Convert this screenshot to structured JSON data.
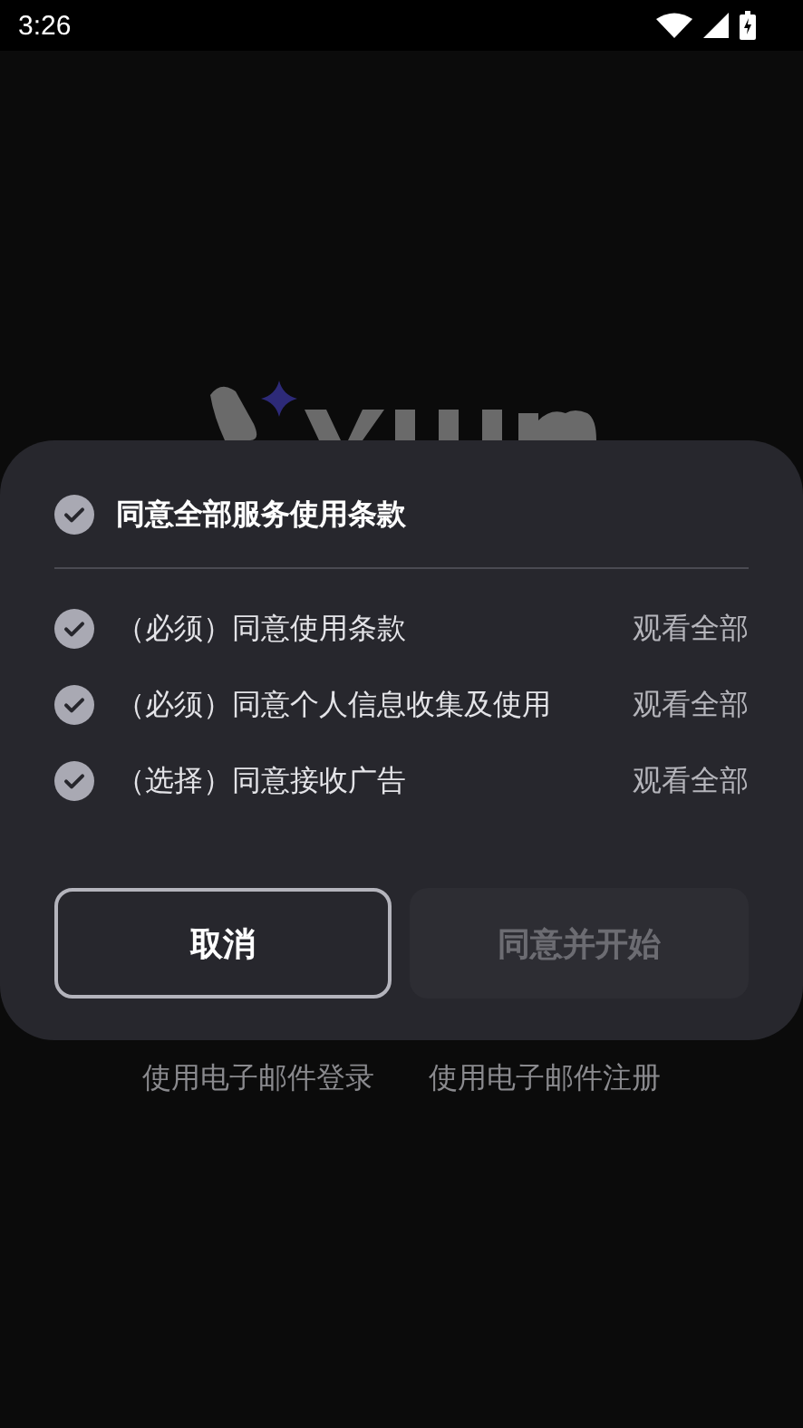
{
  "status_bar": {
    "time": "3:26"
  },
  "dialog": {
    "agree_all": {
      "label": "同意全部服务使用条款",
      "checked": true
    },
    "terms": [
      {
        "label": "（必须）同意使用条款",
        "checked": true,
        "link": "观看全部"
      },
      {
        "label": "（必须）同意个人信息收集及使用",
        "checked": true,
        "link": "观看全部"
      },
      {
        "label": "（选择）同意接收广告",
        "checked": true,
        "link": "观看全部"
      }
    ],
    "cancel_button": "取消",
    "agree_button": {
      "label": "同意并开始",
      "disabled": true
    }
  },
  "links": [
    "使用电子邮件登录",
    "使用电子邮件注册"
  ]
}
